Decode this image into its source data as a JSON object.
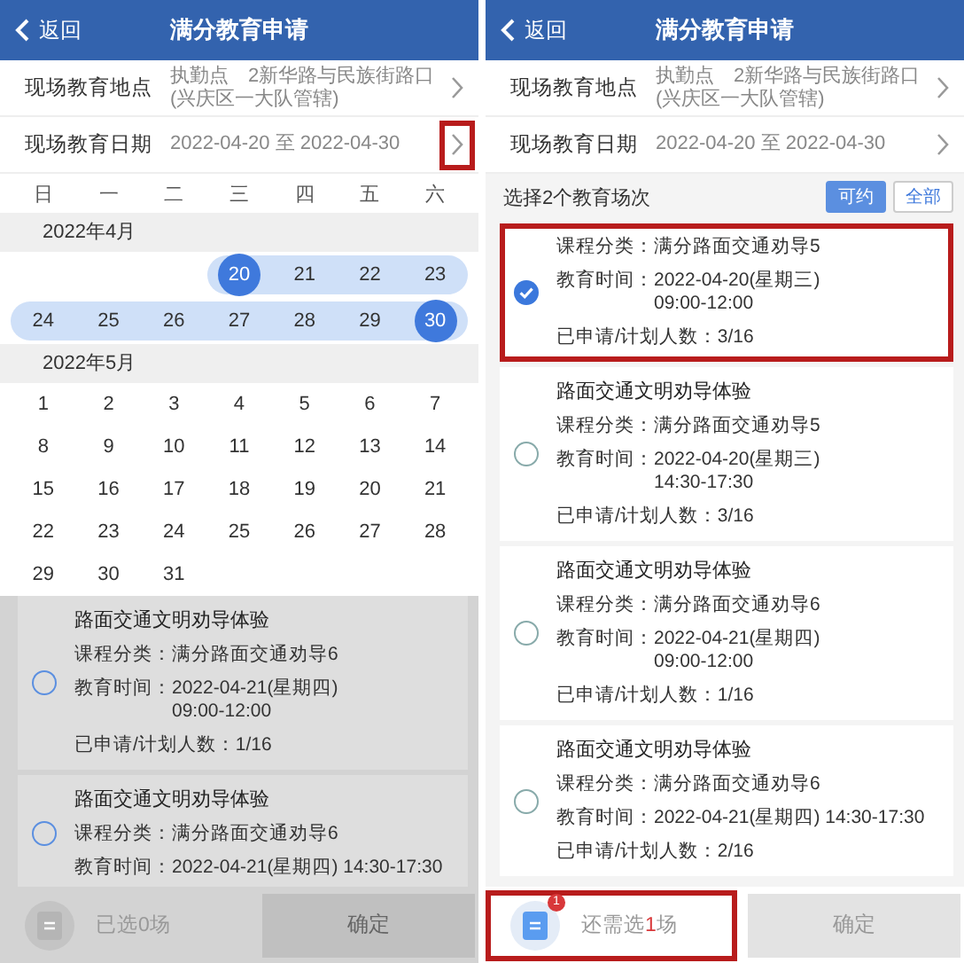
{
  "panels": [
    {
      "header": {
        "back": "返回",
        "title": "满分教育申请"
      },
      "fields": [
        {
          "label": "现场教育地点",
          "value_lines": [
            "执勤点　2新华路与民族街路口",
            "(兴庆区一大队管辖)"
          ],
          "highlighted": false
        },
        {
          "label": "现场教育日期",
          "value_lines": [
            "2022-04-20 至 2022-04-30"
          ],
          "highlighted": true
        }
      ],
      "calendar": {
        "weekdays": [
          "日",
          "一",
          "二",
          "三",
          "四",
          "五",
          "六"
        ],
        "months": [
          {
            "title": "2022年4月",
            "weeks": [
              {
                "days": [
                  {
                    "label": "20",
                    "selected": true,
                    "in_range": true
                  },
                  {
                    "label": "21",
                    "selected": false,
                    "in_range": true
                  },
                  {
                    "label": "22",
                    "selected": false,
                    "in_range": true
                  },
                  {
                    "label": "23",
                    "selected": false,
                    "in_range": true
                  }
                ]
              },
              {
                "days": [
                  {
                    "label": "24",
                    "selected": false,
                    "in_range": true
                  },
                  {
                    "label": "25",
                    "selected": false,
                    "in_range": true
                  },
                  {
                    "label": "26",
                    "selected": false,
                    "in_range": true
                  },
                  {
                    "label": "27",
                    "selected": false,
                    "in_range": true
                  },
                  {
                    "label": "28",
                    "selected": false,
                    "in_range": true
                  },
                  {
                    "label": "29",
                    "selected": false,
                    "in_range": true
                  },
                  {
                    "label": "30",
                    "selected": true,
                    "in_range": true
                  }
                ]
              }
            ]
          },
          {
            "title": "2022年5月",
            "weeks": [
              {
                "days": [
                  {
                    "label": "1",
                    "selected": false,
                    "in_range": false
                  },
                  {
                    "label": "2",
                    "selected": false,
                    "in_range": false
                  },
                  {
                    "label": "3",
                    "selected": false,
                    "in_range": false
                  },
                  {
                    "label": "4",
                    "selected": false,
                    "in_range": false
                  },
                  {
                    "label": "5",
                    "selected": false,
                    "in_range": false
                  },
                  {
                    "label": "6",
                    "selected": false,
                    "in_range": false
                  },
                  {
                    "label": "7",
                    "selected": false,
                    "in_range": false
                  }
                ]
              },
              {
                "days": [
                  {
                    "label": "8",
                    "selected": false,
                    "in_range": false
                  },
                  {
                    "label": "9",
                    "selected": false,
                    "in_range": false
                  },
                  {
                    "label": "10",
                    "selected": false,
                    "in_range": false
                  },
                  {
                    "label": "11",
                    "selected": false,
                    "in_range": false
                  },
                  {
                    "label": "12",
                    "selected": false,
                    "in_range": false
                  },
                  {
                    "label": "13",
                    "selected": false,
                    "in_range": false
                  },
                  {
                    "label": "14",
                    "selected": false,
                    "in_range": false
                  }
                ]
              },
              {
                "days": [
                  {
                    "label": "15",
                    "selected": false,
                    "in_range": false
                  },
                  {
                    "label": "16",
                    "selected": false,
                    "in_range": false
                  },
                  {
                    "label": "17",
                    "selected": false,
                    "in_range": false
                  },
                  {
                    "label": "18",
                    "selected": false,
                    "in_range": false
                  },
                  {
                    "label": "19",
                    "selected": false,
                    "in_range": false
                  },
                  {
                    "label": "20",
                    "selected": false,
                    "in_range": false
                  },
                  {
                    "label": "21",
                    "selected": false,
                    "in_range": false
                  }
                ]
              },
              {
                "days": [
                  {
                    "label": "22",
                    "selected": false,
                    "in_range": false
                  },
                  {
                    "label": "23",
                    "selected": false,
                    "in_range": false
                  },
                  {
                    "label": "24",
                    "selected": false,
                    "in_range": false
                  },
                  {
                    "label": "25",
                    "selected": false,
                    "in_range": false
                  },
                  {
                    "label": "26",
                    "selected": false,
                    "in_range": false
                  },
                  {
                    "label": "27",
                    "selected": false,
                    "in_range": false
                  },
                  {
                    "label": "28",
                    "selected": false,
                    "in_range": false
                  }
                ]
              },
              {
                "days": [
                  {
                    "label": "29",
                    "selected": false,
                    "in_range": false
                  },
                  {
                    "label": "30",
                    "selected": false,
                    "in_range": false
                  },
                  {
                    "label": "31",
                    "selected": false,
                    "in_range": false
                  }
                ]
              }
            ]
          }
        ]
      },
      "sessions": [
        {
          "title": "路面交通文明劝导体验",
          "lines": [
            {
              "label": "课程分类：",
              "values": [
                "满分路面交通劝导6"
              ]
            },
            {
              "label": "教育时间：",
              "values": [
                "2022-04-21(星期四)",
                "09:00-12:00"
              ]
            },
            {
              "label": "已申请/计划人数：",
              "values": [
                "1/16"
              ]
            }
          ],
          "selected": false,
          "highlighted": false
        },
        {
          "title": "路面交通文明劝导体验",
          "lines": [
            {
              "label": "课程分类：",
              "values": [
                "满分路面交通劝导6"
              ]
            },
            {
              "label": "教育时间：",
              "values": [
                "2022-04-21(星期四) 14:30-17:30"
              ]
            }
          ],
          "selected": false,
          "highlighted": false
        }
      ],
      "footer": {
        "status_parts": [
          {
            "text": "已选0场",
            "emphasis": false
          }
        ],
        "confirm": "确定",
        "highlighted": false
      }
    },
    {
      "header": {
        "back": "返回",
        "title": "满分教育申请"
      },
      "fields": [
        {
          "label": "现场教育地点",
          "value_lines": [
            "执勤点　2新华路与民族街路口",
            "(兴庆区一大队管辖)"
          ],
          "highlighted": false
        },
        {
          "label": "现场教育日期",
          "value_lines": [
            "2022-04-20 至 2022-04-30"
          ],
          "highlighted": false
        }
      ],
      "section": {
        "title": "选择2个教育场次",
        "filters": [
          {
            "label": "可约",
            "selected": true
          },
          {
            "label": "全部",
            "selected": false
          }
        ]
      },
      "sessions": [
        {
          "lines": [
            {
              "label": "课程分类：",
              "values": [
                "满分路面交通劝导5"
              ]
            },
            {
              "label": "教育时间：",
              "values": [
                "2022-04-20(星期三)",
                "09:00-12:00"
              ]
            },
            {
              "label": "已申请/计划人数：",
              "values": [
                "3/16"
              ]
            }
          ],
          "selected": true,
          "highlighted": true
        },
        {
          "title": "路面交通文明劝导体验",
          "lines": [
            {
              "label": "课程分类：",
              "values": [
                "满分路面交通劝导5"
              ]
            },
            {
              "label": "教育时间：",
              "values": [
                "2022-04-20(星期三)",
                "14:30-17:30"
              ]
            },
            {
              "label": "已申请/计划人数：",
              "values": [
                "3/16"
              ]
            }
          ],
          "selected": false,
          "highlighted": false
        },
        {
          "title": "路面交通文明劝导体验",
          "lines": [
            {
              "label": "课程分类：",
              "values": [
                "满分路面交通劝导6"
              ]
            },
            {
              "label": "教育时间：",
              "values": [
                "2022-04-21(星期四)",
                "09:00-12:00"
              ]
            },
            {
              "label": "已申请/计划人数：",
              "values": [
                "1/16"
              ]
            }
          ],
          "selected": false,
          "highlighted": false
        },
        {
          "title": "路面交通文明劝导体验",
          "lines": [
            {
              "label": "课程分类：",
              "values": [
                "满分路面交通劝导6"
              ]
            },
            {
              "label": "教育时间：",
              "values": [
                "2022-04-21(星期四) 14:30-17:30"
              ]
            },
            {
              "label": "已申请/计划人数：",
              "values": [
                "2/16"
              ]
            }
          ],
          "selected": false,
          "highlighted": false
        }
      ],
      "footer": {
        "badge": "1",
        "status_parts": [
          {
            "text": "还需选",
            "emphasis": false
          },
          {
            "text": "1",
            "emphasis": true
          },
          {
            "text": "场",
            "emphasis": false
          }
        ],
        "confirm": "确定",
        "highlighted": true
      }
    }
  ]
}
